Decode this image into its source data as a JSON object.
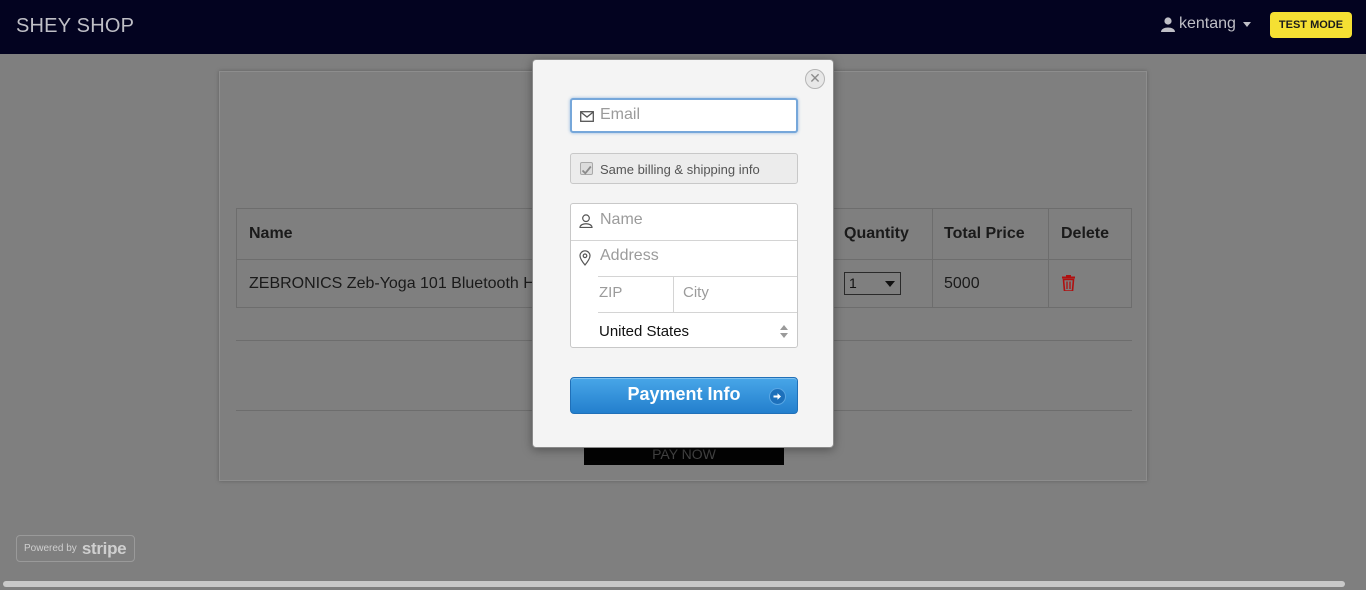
{
  "navbar": {
    "brand": "SHEY SHOP",
    "user": "kentang",
    "test_mode": "TEST MODE"
  },
  "cart": {
    "columns": [
      "Name",
      "Quantity",
      "Total Price",
      "Delete"
    ],
    "rows": [
      {
        "name": "ZEBRONICS Zeb-Yoga 101 Bluetooth He",
        "quantity": "1",
        "total_price": "5000"
      }
    ],
    "pay_now": "PAY NOW"
  },
  "checkout": {
    "email_placeholder": "Email",
    "same_info_label": "Same billing & shipping info",
    "name_placeholder": "Name",
    "address_placeholder": "Address",
    "zip_placeholder": "ZIP",
    "city_placeholder": "City",
    "country": "United States",
    "submit_label": "Payment Info"
  },
  "footer": {
    "powered_by": "Powered by",
    "stripe": "stripe"
  },
  "colors": {
    "navbar": "#030320",
    "accent_blue": "#2f8ed9",
    "test_mode": "#f5e033",
    "delete_red": "#b01010"
  }
}
